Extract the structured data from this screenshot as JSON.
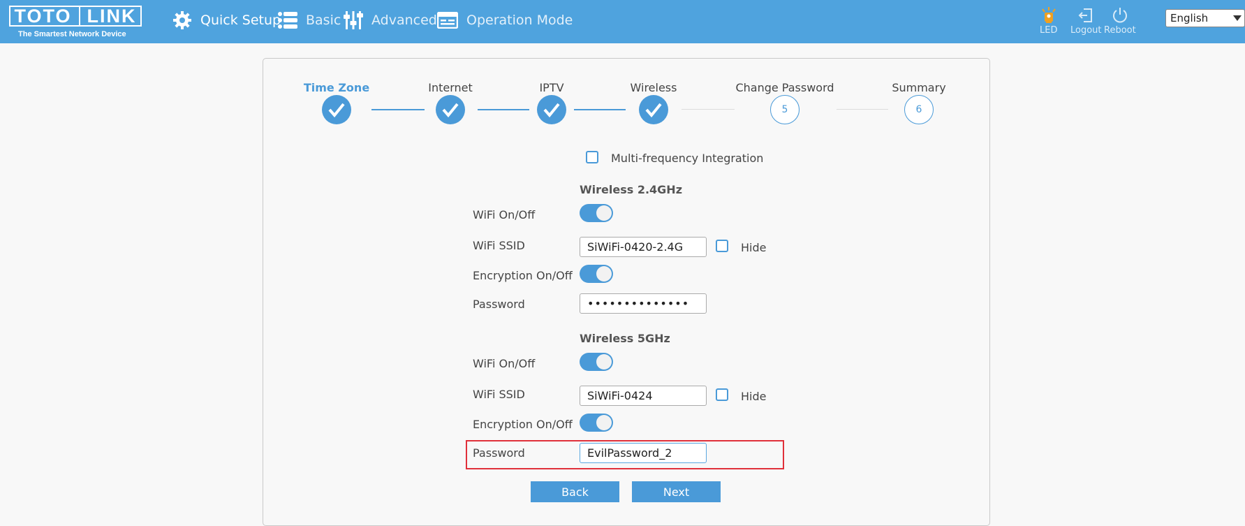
{
  "header": {
    "logo_left": "TOTO",
    "logo_right": "LINK",
    "tagline": "The Smartest Network Device",
    "nav": {
      "quick_setup": "Quick Setup",
      "basic": "Basic",
      "advanced": "Advanced",
      "operation_mode": "Operation Mode"
    },
    "led": "LED",
    "logout": "Logout",
    "reboot": "Reboot",
    "language": "English"
  },
  "steps": [
    {
      "label": "Time Zone",
      "state": "done"
    },
    {
      "label": "Internet",
      "state": "done"
    },
    {
      "label": "IPTV",
      "state": "done"
    },
    {
      "label": "Wireless",
      "state": "done"
    },
    {
      "label": "Change Password",
      "number": "5",
      "state": "todo"
    },
    {
      "label": "Summary",
      "number": "6",
      "state": "todo"
    }
  ],
  "multi_frequency_label": "Multi-frequency Integration",
  "wireless24": {
    "title": "Wireless 2.4GHz",
    "wifi_onoff_label": "WiFi On/Off",
    "ssid_label": "WiFi SSID",
    "ssid_value": "SiWiFi-0420-2.4G",
    "hide_label": "Hide",
    "encryption_label": "Encryption On/Off",
    "password_label": "Password",
    "password_value": "••••••••••••••"
  },
  "wireless5": {
    "title": "Wireless 5GHz",
    "wifi_onoff_label": "WiFi On/Off",
    "ssid_label": "WiFi SSID",
    "ssid_value": "SiWiFi-0424",
    "hide_label": "Hide",
    "encryption_label": "Encryption On/Off",
    "password_label": "Password",
    "password_value": "EvilPassword_2"
  },
  "buttons": {
    "back": "Back",
    "next": "Next"
  },
  "colors": {
    "header": "#4fa3de",
    "accent": "#4a9ad8",
    "highlight": "#e0303a",
    "led": "#f0a020"
  }
}
